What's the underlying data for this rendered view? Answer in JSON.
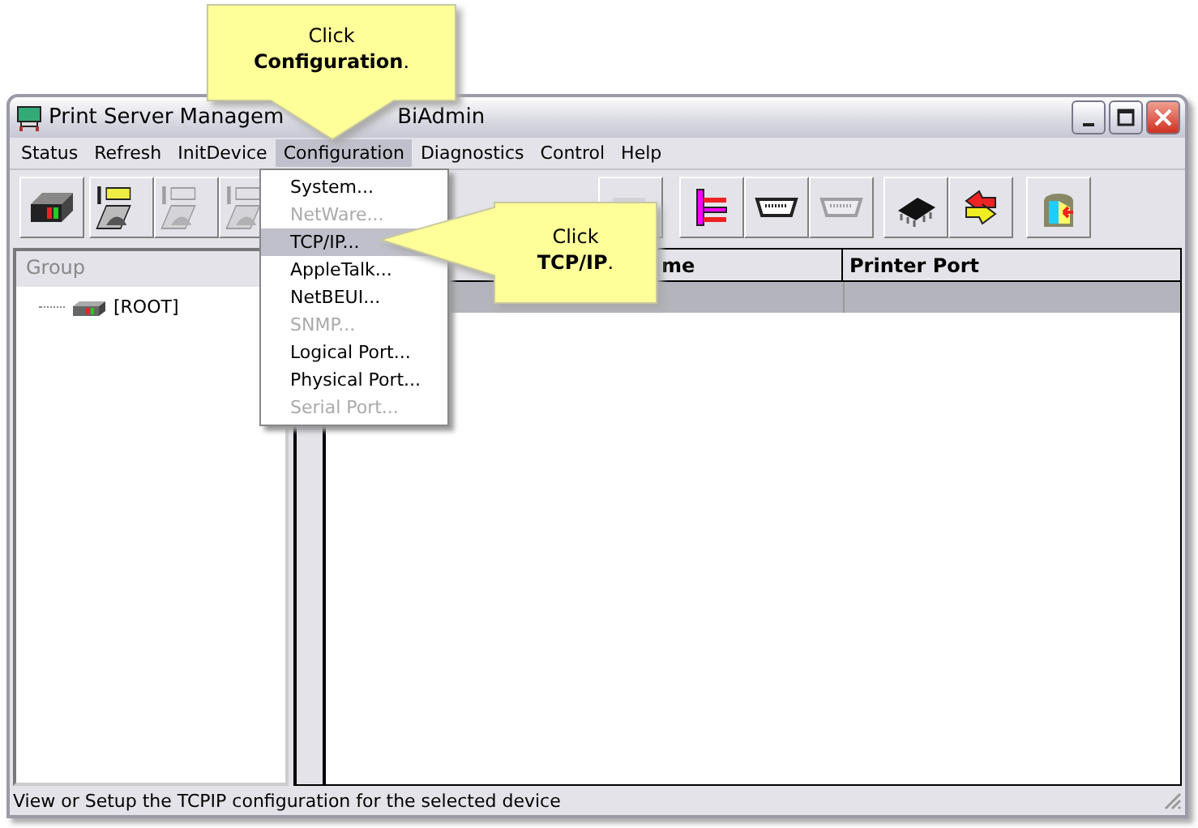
{
  "window": {
    "title_start": "Print Server Managem",
    "title_end": "BiAdmin"
  },
  "menu": [
    {
      "label": "Status",
      "selected": false
    },
    {
      "label": "Refresh",
      "selected": false
    },
    {
      "label": "InitDevice",
      "selected": false
    },
    {
      "label": "Configuration",
      "selected": true
    },
    {
      "label": "Diagnostics",
      "selected": false
    },
    {
      "label": "Control",
      "selected": false
    },
    {
      "label": "Help",
      "selected": false
    }
  ],
  "dropdown": [
    {
      "label": "System...",
      "disabled": false,
      "selected": false
    },
    {
      "label": "NetWare...",
      "disabled": true,
      "selected": false
    },
    {
      "label": "TCP/IP...",
      "disabled": false,
      "selected": true
    },
    {
      "label": "AppleTalk...",
      "disabled": false,
      "selected": false
    },
    {
      "label": "NetBEUI...",
      "disabled": false,
      "selected": false
    },
    {
      "label": "SNMP...",
      "disabled": true,
      "selected": false
    },
    {
      "label": "Logical Port...",
      "disabled": false,
      "selected": false
    },
    {
      "label": "Physical Port...",
      "disabled": false,
      "selected": false
    },
    {
      "label": "Serial Port...",
      "disabled": true,
      "selected": false
    }
  ],
  "toolbar": [
    [
      {
        "kind": "device",
        "disabled": false
      }
    ],
    [
      {
        "kind": "port1",
        "disabled": false
      },
      {
        "kind": "port2",
        "disabled": true
      },
      {
        "kind": "port3",
        "disabled": true
      }
    ],
    [
      {
        "kind": "ghost",
        "disabled": true
      }
    ],
    [
      {
        "kind": "tree",
        "disabled": false
      },
      {
        "kind": "parallel",
        "disabled": false
      },
      {
        "kind": "serial",
        "disabled": true
      }
    ],
    [
      {
        "kind": "chip",
        "disabled": false
      },
      {
        "kind": "swap",
        "disabled": false
      }
    ],
    [
      {
        "kind": "exit",
        "disabled": false
      }
    ]
  ],
  "group_pane": {
    "header": "Group",
    "tree": [
      {
        "label": "[ROOT]"
      }
    ]
  },
  "table": {
    "columns": [
      "me",
      "Printer Port"
    ],
    "rows": [
      {
        "selected": true
      }
    ]
  },
  "status_bar": "View or Setup the TCPIP configuration for the selected device",
  "callouts": [
    {
      "text": "Click\n**Configuration**."
    },
    {
      "text": "Click\n**TCP/IP**."
    }
  ]
}
